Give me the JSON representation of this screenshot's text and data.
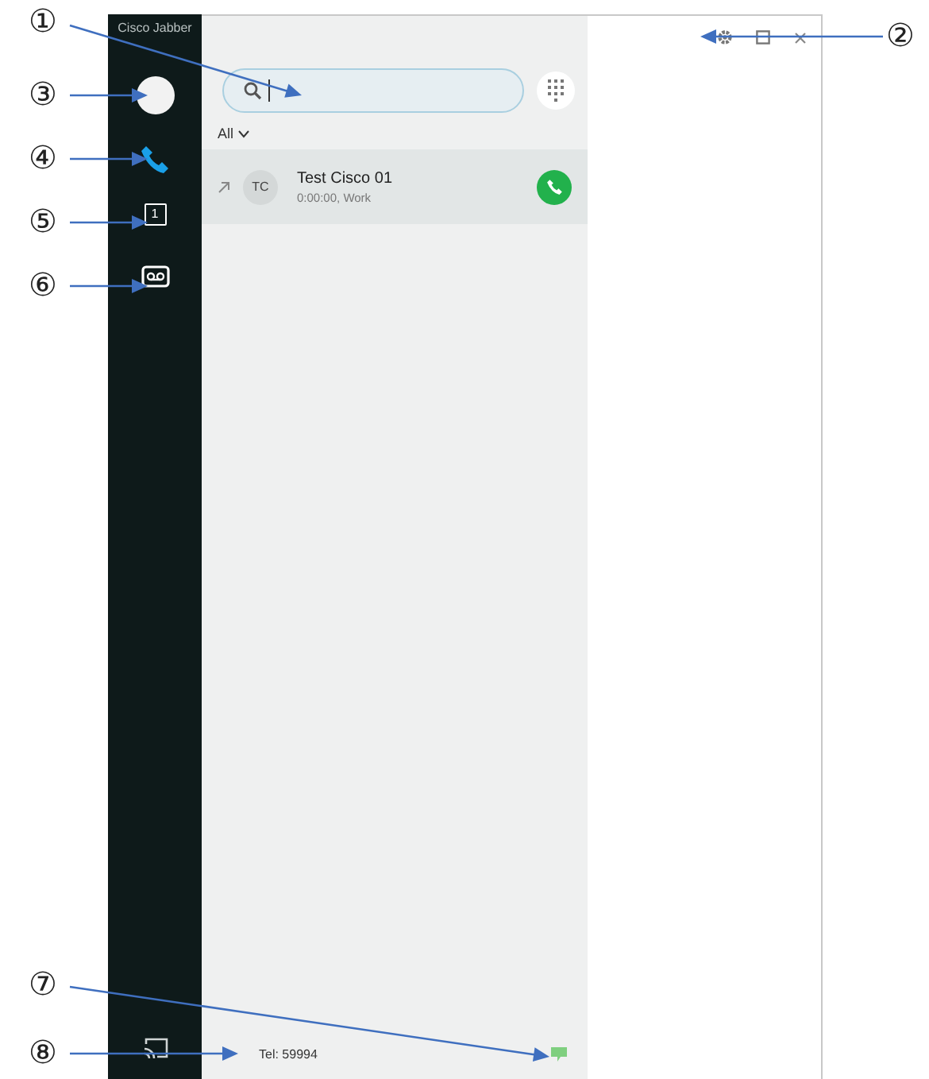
{
  "window": {
    "title": "Cisco Jabber"
  },
  "sidebar": {
    "items": [
      {
        "kind": "avatar",
        "selected": false
      },
      {
        "kind": "phone",
        "selected": true
      },
      {
        "kind": "calendar",
        "label": "1",
        "selected": false
      },
      {
        "kind": "voicemail",
        "selected": false
      }
    ]
  },
  "filter": {
    "label": "All"
  },
  "calls": [
    {
      "initials": "TC",
      "name": "Test Cisco 01",
      "detail": "0:00:00, Work"
    }
  ],
  "status_bar": {
    "phone": "Tel: 59994"
  },
  "callouts": [
    "①",
    "②",
    "③",
    "④",
    "⑤",
    "⑥",
    "⑦",
    "⑧"
  ]
}
